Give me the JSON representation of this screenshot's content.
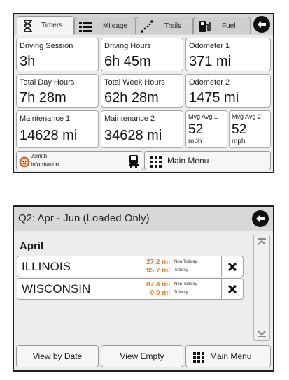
{
  "screen1": {
    "tabs": [
      {
        "label": "Timers",
        "icon": "hourglass-icon",
        "active": true
      },
      {
        "label": "Mileage",
        "icon": "list-icon",
        "active": false
      },
      {
        "label": "Trails",
        "icon": "trail-dots-icon",
        "active": false
      },
      {
        "label": "Fuel",
        "icon": "fuel-pump-icon",
        "active": false
      }
    ],
    "tiles": [
      {
        "title": "Driving Session",
        "value": "3h"
      },
      {
        "title": "Driving Hours",
        "value": "6h 45m"
      },
      {
        "title": "Odometer 1",
        "value": "371 mi"
      },
      {
        "title": "Total Day Hours",
        "value": "7h 28m"
      },
      {
        "title": "Total Week Hours",
        "value": "62h 28m"
      },
      {
        "title": "Odometer 2",
        "value": "1475 mi"
      },
      {
        "title": "Maintenance 1",
        "value": "14628 mi"
      },
      {
        "title": "Maintenance 2",
        "value": "34628 mi"
      }
    ],
    "mpg": [
      {
        "title": "Mvg Avg 1",
        "value": "52",
        "unit": "mph"
      },
      {
        "title": "Mvg Avg 2",
        "value": "52",
        "unit": "mph"
      }
    ],
    "user": {
      "name": "Jsmith",
      "sub": "Information"
    },
    "main_menu": "Main Menu"
  },
  "screen2": {
    "title": "Q2: Apr - Jun (Loaded Only)",
    "month": "April",
    "rows": [
      {
        "state": "ILLINOIS",
        "miles1": "27.2 mi",
        "label1": "Non-Tollway",
        "miles2": "95.7 mi",
        "label2": "Tollway"
      },
      {
        "state": "WISCONSIN",
        "miles1": "87.4 mi",
        "label1": "Non-Tollway",
        "miles2": "0.0 mi",
        "label2": "Tollway"
      }
    ],
    "buttons": {
      "by_date": "View by Date",
      "empty": "View Empty",
      "main_menu": "Main Menu"
    }
  },
  "colors": {
    "orange": "#e2862a",
    "frame": "#1e1e1e",
    "panel": "#ececec"
  }
}
